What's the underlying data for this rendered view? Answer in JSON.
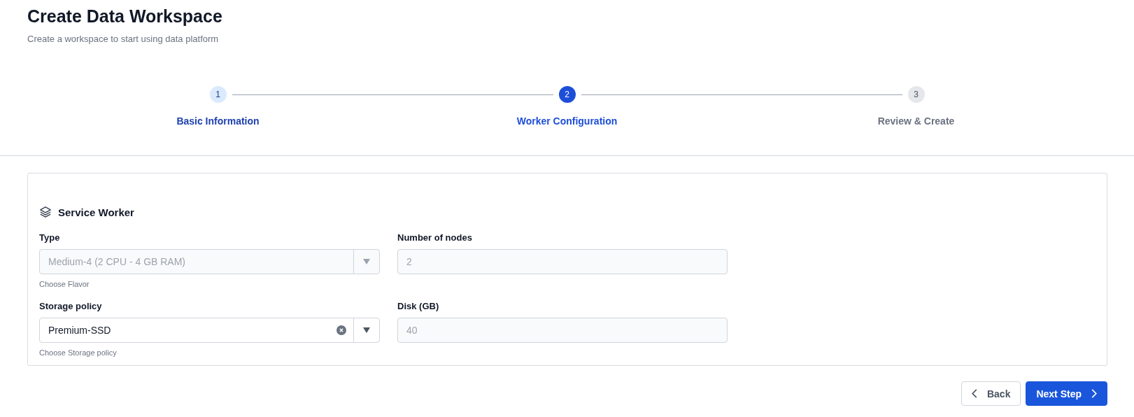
{
  "header": {
    "title": "Create Data Workspace",
    "subtitle": "Create a workspace to start using data platform"
  },
  "steps": [
    {
      "number": "1",
      "label": "Basic Information",
      "completed": true,
      "selected": false
    },
    {
      "number": "2",
      "label": "Worker Configuration",
      "completed": false,
      "selected": true
    },
    {
      "number": "3",
      "label": "Review & Create",
      "completed": false,
      "selected": false
    }
  ],
  "section": {
    "title": "Service Worker"
  },
  "fields": [
    {
      "kind": "select",
      "label": "Type",
      "value": "Medium-4 (2 CPU - 4 GB RAM)",
      "disabled": true,
      "helper": "Choose Flavor"
    },
    {
      "kind": "input",
      "label": "Number of nodes",
      "value": "2",
      "disabled": true
    },
    {
      "kind": "select",
      "label": "Storage policy",
      "value": "Premium-SSD",
      "disabled": false,
      "clearable": true,
      "helper": "Choose Storage policy"
    },
    {
      "kind": "input",
      "label": "Disk (GB)",
      "value": "40",
      "disabled": true
    }
  ],
  "buttons": {
    "back": "Back",
    "next": "Next Step"
  }
}
